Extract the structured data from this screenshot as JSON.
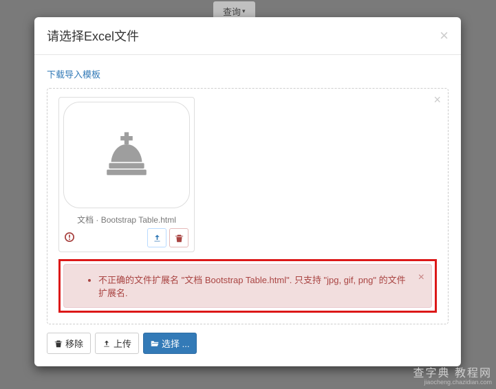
{
  "background": {
    "query_btn": "查询"
  },
  "modal": {
    "title": "请选择Excel文件",
    "template_link": "下载导入模板",
    "file": {
      "caption": "文档 · Bootstrap Table.html"
    },
    "error": {
      "message": "不正确的文件扩展名 \"文档 Bootstrap Table.html\". 只支持 \"jpg, gif, png\" 的文件扩展名."
    },
    "toolbar": {
      "remove": "移除",
      "upload": "上传",
      "select": "选择 ..."
    }
  },
  "watermark": {
    "main": "查字典 教程网",
    "sub": "jiaocheng.chazidian.com"
  }
}
